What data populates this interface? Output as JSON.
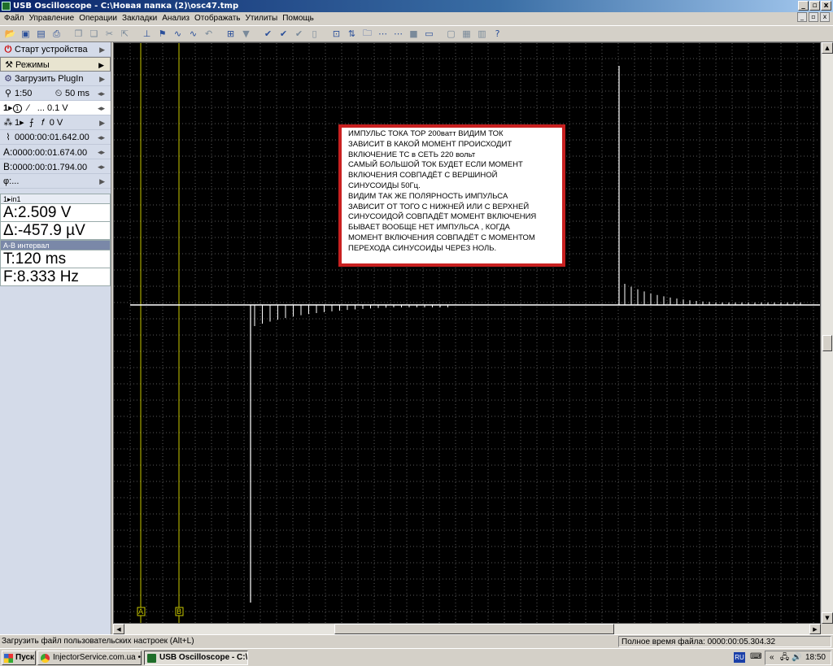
{
  "window": {
    "title": "USB Oscilloscope - C:\\Новая папка (2)\\osc47.tmp",
    "controls": [
      "_",
      "▫",
      "x"
    ]
  },
  "menu": [
    "Файл",
    "Управление",
    "Операции",
    "Закладки",
    "Анализ",
    "Отображать",
    "Утилиты",
    "Помощь"
  ],
  "panel": {
    "start_device": "Старт устройства",
    "modes": "Режимы",
    "load_plugin": "Загрузить PlugIn",
    "zoom": "1:50",
    "timebase": "50 ms",
    "channel_volts": "... 0.1 V",
    "trigger_level": "0 V",
    "trigger_time": "0000:00:01.642.00",
    "cursor_a": "0000:00:01.674.00",
    "cursor_b": "0000:00:01.794.00",
    "phi": "...",
    "channel_name": "in1",
    "value_a": "A:2.509 V",
    "value_delta": "Δ:-457.9 µV",
    "interval_title": "A-B интервал",
    "interval_t": "T:120 ms",
    "interval_f": "F:8.333 Hz",
    "label_a": "A:",
    "label_b": "B:",
    "label_phi": "φ:",
    "channel_num": "1",
    "trig_ch": "1"
  },
  "annotation": [
    "ИМПУЛЬС  ТОКА  ТОР  200ватт  ВИДИМ  ТОК",
    "ЗАВИСИТ В КАКОЙ  МОМЕНТ ПРОИСХОДИТ",
    "ВКЛЮЧЕНИЕ  ТС  в  СЕТЬ 220 вольт",
    "САМЫЙ БОЛЬШОЙ ТОК БУДЕТ ЕСЛИ  МОМЕНТ",
    "ВКЛЮЧЕНИЯ  СОВПАДЁТ  С  ВЕРШИНОЙ",
    "СИНУСОИДЫ  50Гц.",
    "ВИДИМ  ТАК ЖЕ ПОЛЯРНОСТЬ ИМПУЛЬСА",
    "ЗАВИСИТ  ОТ ТОГО  С  НИЖНЕЙ ИЛИ  С ВЕРХНЕЙ",
    "СИНУСОИДОЙ  СОВПАДЁТ  МОМЕНТ  ВКЛЮЧЕНИЯ",
    "БЫВАЕТ  ВООБЩЕ НЕТ  ИМПУЛЬСА , КОГДА",
    "МОМЕНТ ВКЛЮЧЕНИЯ  СОВПАДЁТ  С  МОМЕНТОМ",
    "ПЕРЕХОДА  СИНУСОИДЫ  ЧЕРЕЗ  НОЛЬ."
  ],
  "markers": {
    "a": "A",
    "b": "B"
  },
  "status": {
    "hint": "Загрузить файл пользовательских настроек (Alt+L)",
    "file_time": "Полное время файла: 0000:00:05.304.32"
  },
  "taskbar": {
    "start": "Пуск",
    "task1": "InjectorService.com.ua • настрое...",
    "task2": "USB Oscilloscope - C:\\...",
    "lang": "RU",
    "clock": "18:50"
  },
  "colors": {
    "screen": "#000000",
    "grid": "#5a5a5a",
    "trace": "#ffffff",
    "cursor": "#c8c800",
    "note_border": "#c82020"
  },
  "icons": [
    "power-icon",
    "wrench-icon",
    "plugin-icon",
    "zoom-icon",
    "timebase-icon",
    "channel-icon",
    "trigger-icon",
    "clock-icon"
  ]
}
